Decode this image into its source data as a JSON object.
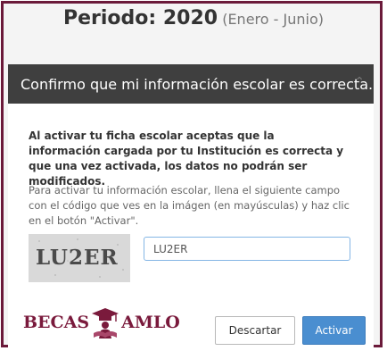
{
  "period": {
    "label": "Periodo: 2020",
    "range": "(Enero - Junio)"
  },
  "modal": {
    "title": "Confirmo que mi información escolar es correcta.",
    "close_icon": "close-icon",
    "notice": "Al activar tu ficha escolar aceptas que la información cargada por tu Institución es correcta y que una vez activada, los datos no podrán ser modificados.",
    "instructions": "Para activar tu información escolar, llena el siguiente campo con el código que ves en la imágen (en mayúsculas) y haz clic en el botón \"Activar\".",
    "captcha_text": "LU2ER",
    "code_field_value": "LU2ER",
    "discard_label": "Descartar",
    "activate_label": "Activar"
  },
  "logo": {
    "left": "BECAS",
    "right": "AMLO",
    "emblem_icon": "graduation-cap-icon"
  },
  "colors": {
    "frame": "#6b1a3a",
    "header_bg": "#3f3f3f",
    "activate_bg": "#4a8ed0",
    "logo": "#7a1a3c"
  }
}
